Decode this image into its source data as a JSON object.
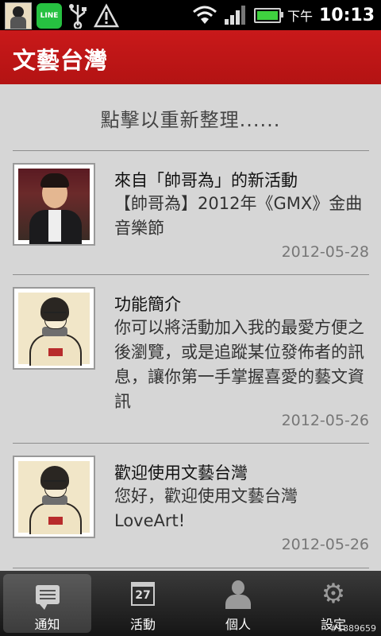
{
  "status_bar": {
    "notif_icons": [
      "app-thumbnail-icon",
      "line-app-icon",
      "usb-icon",
      "warning-icon"
    ],
    "line_label": "LINE",
    "ampm": "下午",
    "time": "10:13"
  },
  "title_bar": {
    "title": "文藝台灣"
  },
  "content": {
    "refresh_label": "點擊以重新整理......",
    "items": [
      {
        "title": "來自「帥哥為」的新活動",
        "desc": "【帥哥為】2012年《GMX》金曲音樂節",
        "date": "2012-05-28",
        "thumb": "person-photo"
      },
      {
        "title": "功能簡介",
        "desc": "你可以將活動加入我的最愛方便之後瀏覽，或是追蹤某位發佈者的訊息，讓你第一手掌握喜愛的藝文資訊",
        "date": "2012-05-26",
        "thumb": "reading-sketch"
      },
      {
        "title": "歡迎使用文藝台灣",
        "desc": "您好，歡迎使用文藝台灣LoveArt!",
        "date": "2012-05-26",
        "thumb": "reading-sketch"
      }
    ]
  },
  "tabs": [
    {
      "label": "通知",
      "icon": "message-icon",
      "active": true
    },
    {
      "label": "活動",
      "icon": "calendar-icon",
      "calendar_day": "27"
    },
    {
      "label": "個人",
      "icon": "person-icon"
    },
    {
      "label": "設定",
      "icon": "gear-icon"
    }
  ],
  "watermark": "#1889659",
  "colors": {
    "accent": "#c0161a",
    "background": "#d6d6d6"
  }
}
